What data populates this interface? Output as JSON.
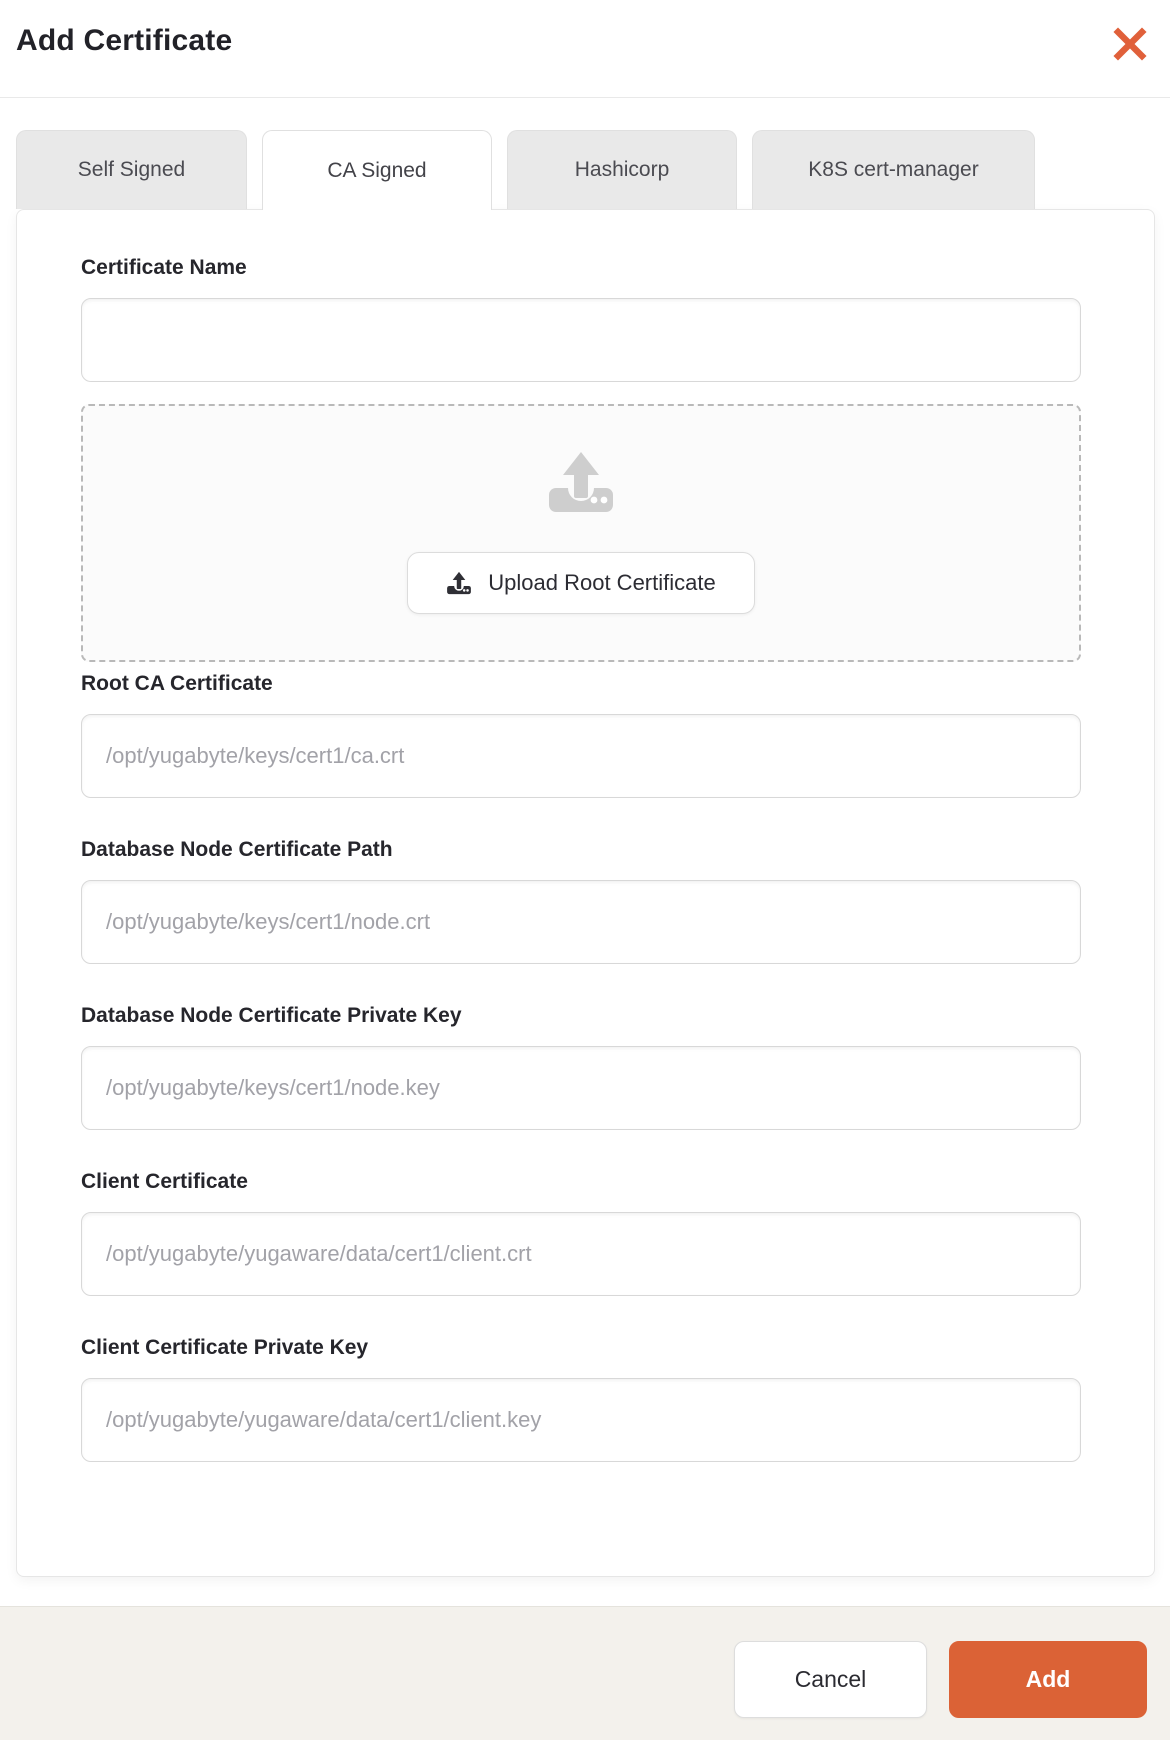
{
  "modal": {
    "title": "Add Certificate"
  },
  "icons": {
    "close_icon": "✕",
    "upload_icon": "⤒"
  },
  "tabs": [
    {
      "label": "Self Signed",
      "active": false
    },
    {
      "label": "CA Signed",
      "active": true
    },
    {
      "label": "Hashicorp",
      "active": false
    },
    {
      "label": "K8S cert-manager",
      "active": false
    }
  ],
  "form": {
    "fields": [
      {
        "label": "Certificate Name",
        "value": "",
        "placeholder": ""
      },
      {
        "label": "Root CA Certificate",
        "value": "",
        "placeholder": "/opt/yugabyte/keys/cert1/ca.crt"
      },
      {
        "label": "Database Node Certificate Path",
        "value": "",
        "placeholder": "/opt/yugabyte/keys/cert1/node.crt"
      },
      {
        "label": "Database Node Certificate Private Key",
        "value": "",
        "placeholder": "/opt/yugabyte/keys/cert1/node.key"
      },
      {
        "label": "Client Certificate",
        "value": "",
        "placeholder": "/opt/yugabyte/yugaware/data/cert1/client.crt"
      },
      {
        "label": "Client Certificate Private Key",
        "value": "",
        "placeholder": "/opt/yugabyte/yugaware/data/cert1/client.key"
      }
    ],
    "upload_button_label": "Upload Root Certificate"
  },
  "footer": {
    "cancel_label": "Cancel",
    "add_label": "Add"
  },
  "colors": {
    "accent_orange": "#db6236",
    "close_orange": "#e0603a",
    "footer_bg": "#f3f1ec",
    "tab_inactive_bg": "#e9e9e9",
    "placeholder_gray": "#a2a2a8"
  }
}
